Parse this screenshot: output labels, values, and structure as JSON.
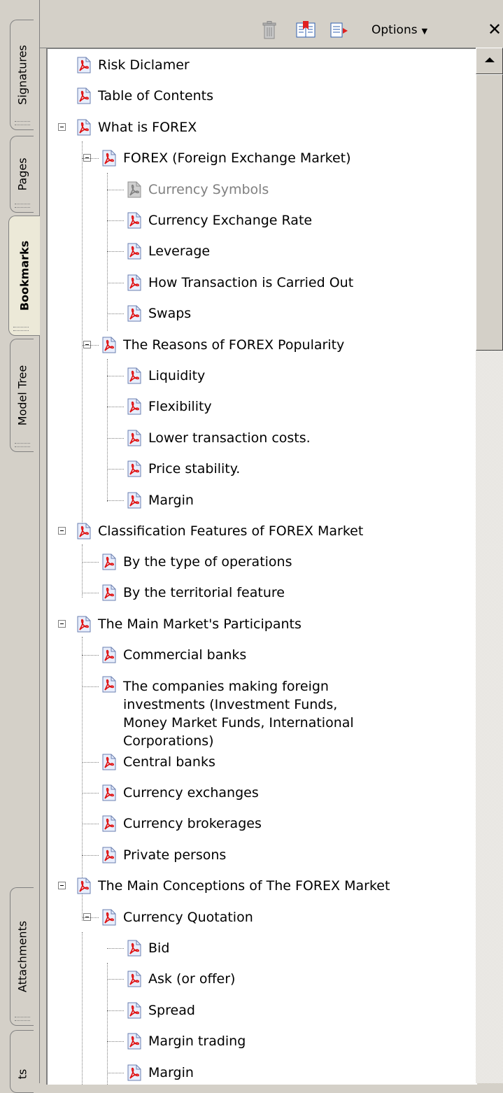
{
  "tabs": {
    "signatures": "Signatures",
    "pages": "Pages",
    "bookmarks": "Bookmarks",
    "model_tree": "Model Tree",
    "attachments": "Attachments",
    "comments_partial": "ts"
  },
  "toolbar": {
    "delete_icon": "trash-icon",
    "new_bookmark_icon": "new-bookmark-icon",
    "expand_icon": "expand-bookmark-icon",
    "options_label": "Options",
    "close_label": "✕"
  },
  "bookmarks": [
    {
      "label": "Risk Diclamer"
    },
    {
      "label": "Table of Contents"
    },
    {
      "label": "What is FOREX"
    },
    {
      "label": "FOREX (Foreign Exchange Market)"
    },
    {
      "label": "Currency Symbols"
    },
    {
      "label": "Currency Exchange Rate"
    },
    {
      "label": "Leverage"
    },
    {
      "label": "How Transaction is Carried Out"
    },
    {
      "label": "Swaps"
    },
    {
      "label": "The Reasons of FOREX Popularity"
    },
    {
      "label": "Liquidity"
    },
    {
      "label": "Flexibility"
    },
    {
      "label": "Lower transaction costs."
    },
    {
      "label": "Price stability."
    },
    {
      "label": "Margin"
    },
    {
      "label": "Classification Features of FOREX Market"
    },
    {
      "label": "By the type of operations"
    },
    {
      "label": "By the territorial feature"
    },
    {
      "label": "The Main Market's Participants"
    },
    {
      "label": "Commercial banks"
    },
    {
      "label": "The companies making foreign investments (Investment Funds, Money Market Funds, International Corporations)"
    },
    {
      "label": "Central banks"
    },
    {
      "label": "Currency exchanges"
    },
    {
      "label": "Currency brokerages"
    },
    {
      "label": "Private persons"
    },
    {
      "label": "The Main Conceptions of The FOREX Market"
    },
    {
      "label": "Currency Quotation"
    },
    {
      "label": "Bid"
    },
    {
      "label": "Ask (or offer)"
    },
    {
      "label": "Spread"
    },
    {
      "label": "Margin trading"
    },
    {
      "label": "Margin"
    }
  ]
}
